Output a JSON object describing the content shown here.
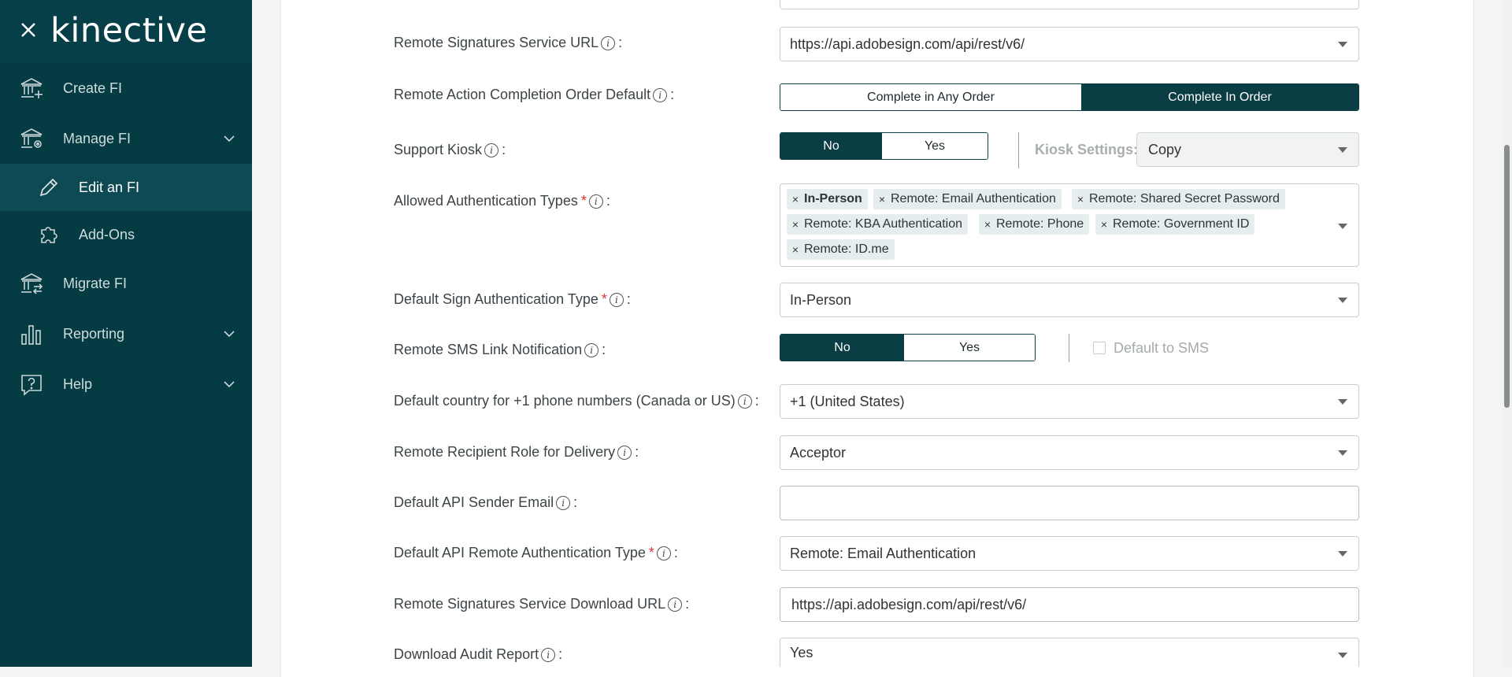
{
  "app": {
    "brand": "kinective"
  },
  "sidebar": {
    "items": [
      {
        "label": "Create FI",
        "icon": "bank-plus-icon"
      },
      {
        "label": "Manage FI",
        "icon": "bank-gear-icon"
      },
      {
        "label": "Edit an FI",
        "icon": "pencil-icon"
      },
      {
        "label": "Add-Ons",
        "icon": "puzzle-icon"
      },
      {
        "label": "Migrate FI",
        "icon": "bank-arrows-icon"
      },
      {
        "label": "Reporting",
        "icon": "bar-chart-icon"
      },
      {
        "label": "Help",
        "icon": "help-bubble-icon"
      }
    ]
  },
  "form": {
    "remote_signatures_service_url": {
      "label": "Remote Signatures Service URL",
      "value": "https://api.adobesign.com/api/rest/v6/"
    },
    "remote_action_completion_order": {
      "label": "Remote Action Completion Order Default",
      "options": [
        "Complete in Any Order",
        "Complete In Order"
      ],
      "selected": "Complete In Order"
    },
    "support_kiosk": {
      "label": "Support Kiosk",
      "options": [
        "No",
        "Yes"
      ],
      "selected": "No",
      "kiosk_settings_label": "Kiosk Settings:",
      "kiosk_settings_value": "Copy"
    },
    "allowed_authentication_types": {
      "label": "Allowed Authentication Types",
      "tags": [
        "In-Person",
        "Remote: Email Authentication",
        "Remote: Shared Secret Password",
        "Remote: KBA Authentication",
        "Remote: Phone",
        "Remote: Government ID",
        "Remote: ID.me"
      ]
    },
    "default_sign_authentication_type": {
      "label": "Default Sign Authentication Type",
      "value": "In-Person"
    },
    "remote_sms_link_notification": {
      "label": "Remote SMS Link Notification",
      "options": [
        "No",
        "Yes"
      ],
      "selected": "No",
      "checkbox_label": "Default to SMS"
    },
    "default_country": {
      "label": "Default country for +1 phone numbers (Canada or US)",
      "value": "+1 (United States)"
    },
    "remote_recipient_role": {
      "label": "Remote Recipient Role for Delivery",
      "value": "Acceptor"
    },
    "default_api_sender_email": {
      "label": "Default API Sender Email",
      "value": ""
    },
    "default_api_remote_auth_type": {
      "label": "Default API Remote Authentication Type",
      "value": "Remote: Email Authentication"
    },
    "remote_signatures_download_url": {
      "label": "Remote Signatures Service Download URL",
      "value": "https://api.adobesign.com/api/rest/v6/"
    },
    "download_audit_report": {
      "label": "Download Audit Report",
      "value": "Yes"
    }
  },
  "colors": {
    "sidebar_bg": "#053b43",
    "accent": "#0b3d45",
    "required": "#d9322f",
    "tag_bg": "#e6edee"
  }
}
